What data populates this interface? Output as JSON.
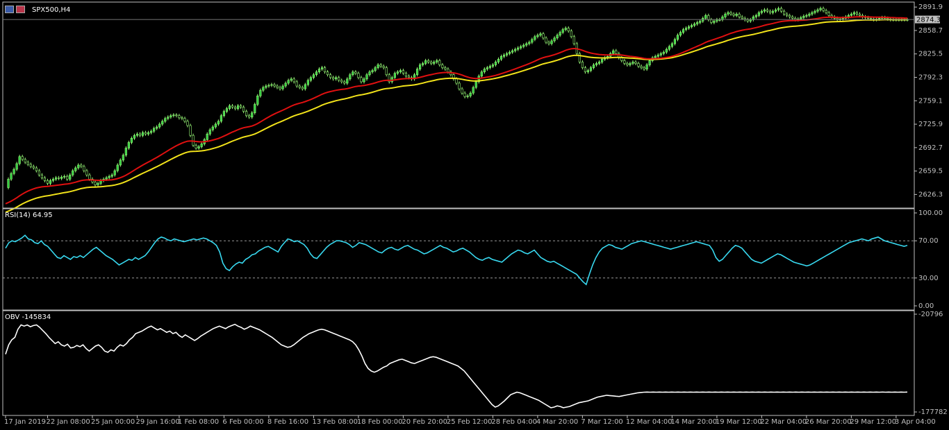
{
  "window": {
    "symbol_label": "SPX500,H4",
    "rsi_label": "RSI(14) 64.95",
    "obv_label": "OBV -145834",
    "current_price": "2874.3"
  },
  "colors": {
    "background": "#000000",
    "frame": "#c0c0c0",
    "bull_candle": "#2ecc40",
    "candle_wick": "#9cff7a",
    "ma_fast": "#e01010",
    "ma_slow": "#f2e31a",
    "rsi_line": "#38d9f0",
    "obv_line": "#ffffff",
    "level_line": "#b0b0b0"
  },
  "icons": [
    "chart-window-icon",
    "us-flag-icon"
  ],
  "chart_data": [
    {
      "type": "line",
      "name": "price",
      "title": "SPX500,H4",
      "ylim": [
        2609,
        2896
      ],
      "yticks": [
        "2891.9",
        "2858.7",
        "2825.5",
        "2792.3",
        "2759.1",
        "2725.9",
        "2692.7",
        "2659.5",
        "2626.3"
      ],
      "ytick_values": [
        2891.9,
        2858.7,
        2825.5,
        2792.3,
        2759.1,
        2725.9,
        2692.7,
        2659.5,
        2626.3
      ],
      "xticks": [
        "17 Jan 2019",
        "22 Jan 08:00",
        "25 Jan 00:00",
        "29 Jan 16:00",
        "1 Feb 08:00",
        "6 Feb 00:00",
        "8 Feb 16:00",
        "13 Feb 08:00",
        "18 Feb 00:00",
        "20 Feb 20:00",
        "25 Feb 12:00",
        "28 Feb 04:00",
        "4 Mar 20:00",
        "7 Mar 12:00",
        "12 Mar 04:00",
        "14 Mar 20:00",
        "19 Mar 12:00",
        "22 Mar 04:00",
        "26 Mar 20:00",
        "29 Mar 12:00",
        "3 Apr 04:00"
      ],
      "xtick_index": [
        0,
        15,
        31,
        47,
        62,
        78,
        94,
        110,
        126,
        142,
        158,
        174,
        190,
        206,
        222,
        238,
        254,
        270,
        286,
        302,
        318
      ],
      "close": [
        2636,
        2648,
        2656,
        2662,
        2670,
        2680,
        2676,
        2672,
        2669,
        2666,
        2664,
        2660,
        2654,
        2650,
        2646,
        2642,
        2646,
        2648,
        2650,
        2649,
        2651,
        2652,
        2648,
        2654,
        2660,
        2664,
        2668,
        2666,
        2660,
        2654,
        2648,
        2644,
        2640,
        2642,
        2646,
        2648,
        2650,
        2652,
        2654,
        2660,
        2668,
        2675,
        2682,
        2692,
        2700,
        2706,
        2710,
        2712,
        2710,
        2714,
        2712,
        2714,
        2716,
        2720,
        2722,
        2726,
        2730,
        2734,
        2736,
        2738,
        2739,
        2738,
        2735,
        2734,
        2730,
        2724,
        2710,
        2696,
        2692,
        2694,
        2698,
        2704,
        2712,
        2718,
        2722,
        2726,
        2730,
        2738,
        2744,
        2748,
        2752,
        2750,
        2748,
        2752,
        2750,
        2744,
        2738,
        2736,
        2742,
        2754,
        2766,
        2774,
        2778,
        2780,
        2781,
        2782,
        2780,
        2778,
        2776,
        2780,
        2784,
        2788,
        2790,
        2786,
        2780,
        2778,
        2776,
        2782,
        2788,
        2792,
        2796,
        2800,
        2804,
        2806,
        2800,
        2796,
        2792,
        2790,
        2792,
        2788,
        2786,
        2784,
        2790,
        2796,
        2800,
        2798,
        2792,
        2786,
        2790,
        2796,
        2800,
        2802,
        2806,
        2810,
        2808,
        2806,
        2796,
        2786,
        2792,
        2798,
        2800,
        2802,
        2798,
        2794,
        2792,
        2790,
        2796,
        2804,
        2810,
        2812,
        2816,
        2814,
        2812,
        2814,
        2816,
        2810,
        2806,
        2804,
        2800,
        2796,
        2790,
        2784,
        2776,
        2770,
        2765,
        2766,
        2770,
        2778,
        2786,
        2794,
        2800,
        2804,
        2806,
        2808,
        2810,
        2814,
        2818,
        2822,
        2824,
        2826,
        2828,
        2830,
        2832,
        2834,
        2836,
        2838,
        2840,
        2842,
        2846,
        2850,
        2852,
        2854,
        2848,
        2842,
        2840,
        2844,
        2848,
        2852,
        2856,
        2860,
        2862,
        2858,
        2850,
        2840,
        2826,
        2814,
        2806,
        2800,
        2802,
        2806,
        2810,
        2812,
        2814,
        2818,
        2820,
        2822,
        2826,
        2830,
        2826,
        2820,
        2816,
        2812,
        2810,
        2812,
        2814,
        2812,
        2808,
        2806,
        2804,
        2810,
        2816,
        2820,
        2822,
        2824,
        2826,
        2828,
        2832,
        2836,
        2840,
        2846,
        2852,
        2856,
        2860,
        2862,
        2864,
        2866,
        2868,
        2870,
        2872,
        2876,
        2880,
        2874,
        2870,
        2872,
        2874,
        2874,
        2878,
        2882,
        2884,
        2882,
        2880,
        2882,
        2878,
        2876,
        2874,
        2872,
        2874,
        2878,
        2880,
        2884,
        2886,
        2888,
        2886,
        2884,
        2886,
        2888,
        2890,
        2886,
        2882,
        2880,
        2878,
        2876,
        2874,
        2875,
        2877,
        2879,
        2880,
        2882,
        2884,
        2886,
        2888,
        2890,
        2887,
        2884,
        2880,
        2878,
        2876,
        2874,
        2875,
        2876,
        2878,
        2880,
        2882,
        2884,
        2882,
        2880,
        2878,
        2877,
        2876,
        2875,
        2874,
        2875,
        2876,
        2877,
        2876,
        2875,
        2874,
        2874,
        2874,
        2874,
        2874,
        2874,
        2874
      ],
      "series": [
        {
          "name": "ma_fast",
          "start": 2612,
          "end": 2847
        },
        {
          "name": "ma_slow",
          "start": 2600,
          "end": 2830
        }
      ],
      "current_price": 2874.3
    },
    {
      "type": "line",
      "name": "rsi",
      "title": "RSI(14) 64.95",
      "ylim": [
        0,
        100
      ],
      "yticks": [
        "100.00",
        "70.00",
        "30.00",
        "0.00"
      ],
      "ytick_values": [
        100,
        70,
        30,
        0
      ],
      "levels": [
        70,
        30
      ],
      "values": [
        62,
        68,
        70,
        69,
        71,
        73,
        76,
        72,
        71,
        68,
        67,
        70,
        66,
        64,
        60,
        56,
        52,
        51,
        54,
        52,
        50,
        53,
        52,
        54,
        52,
        55,
        58,
        61,
        63,
        60,
        57,
        54,
        52,
        50,
        47,
        44,
        46,
        48,
        50,
        49,
        52,
        50,
        52,
        54,
        58,
        63,
        68,
        72,
        74,
        73,
        71,
        70,
        72,
        71,
        70,
        69,
        70,
        71,
        72,
        71,
        72,
        73,
        72,
        70,
        68,
        65,
        58,
        46,
        40,
        38,
        42,
        45,
        47,
        46,
        50,
        52,
        55,
        56,
        59,
        61,
        63,
        64,
        62,
        60,
        58,
        64,
        68,
        72,
        71,
        69,
        70,
        68,
        66,
        62,
        56,
        52,
        51,
        55,
        59,
        63,
        66,
        68,
        70,
        70,
        69,
        68,
        66,
        63,
        65,
        68,
        67,
        66,
        64,
        62,
        60,
        58,
        57,
        60,
        62,
        63,
        61,
        60,
        62,
        64,
        65,
        63,
        61,
        60,
        58,
        56,
        57,
        59,
        61,
        63,
        65,
        63,
        62,
        60,
        58,
        59,
        61,
        62,
        60,
        58,
        55,
        52,
        50,
        49,
        51,
        52,
        50,
        49,
        48,
        47,
        50,
        53,
        56,
        58,
        60,
        59,
        57,
        56,
        58,
        60,
        56,
        52,
        50,
        48,
        47,
        48,
        46,
        44,
        42,
        40,
        38,
        36,
        34,
        30,
        26,
        23,
        34,
        44,
        52,
        58,
        62,
        64,
        66,
        65,
        63,
        62,
        61,
        63,
        65,
        67,
        68,
        69,
        70,
        69,
        68,
        67,
        66,
        65,
        64,
        63,
        62,
        61,
        62,
        63,
        64,
        65,
        66,
        67,
        68,
        69,
        68,
        67,
        66,
        65,
        60,
        52,
        48,
        50,
        54,
        58,
        62,
        65,
        64,
        62,
        58,
        54,
        50,
        48,
        47,
        46,
        48,
        50,
        52,
        54,
        56,
        55,
        53,
        51,
        49,
        47,
        46,
        45,
        44,
        43,
        44,
        46,
        48,
        50,
        52,
        54,
        56,
        58,
        60,
        62,
        64,
        66,
        68,
        69,
        70,
        71,
        72,
        71,
        70,
        72,
        73,
        74,
        72,
        70,
        69,
        68,
        67,
        66,
        65,
        64,
        65
      ],
      "current": 64.95
    },
    {
      "type": "line",
      "name": "obv",
      "title": "OBV -145834",
      "ylim": [
        -177782,
        -20796
      ],
      "yticks": [
        "-20796",
        "-177782"
      ],
      "ytick_values": [
        -20796,
        -177782
      ],
      "values": [
        -85000,
        -70000,
        -62000,
        -58000,
        -45000,
        -38000,
        -40000,
        -38000,
        -41000,
        -39000,
        -38000,
        -42000,
        -47000,
        -52000,
        -58000,
        -63000,
        -68000,
        -65000,
        -70000,
        -72000,
        -69000,
        -75000,
        -74000,
        -71000,
        -73000,
        -70000,
        -76000,
        -80000,
        -76000,
        -72000,
        -70000,
        -74000,
        -80000,
        -82000,
        -78000,
        -80000,
        -74000,
        -70000,
        -72000,
        -68000,
        -62000,
        -58000,
        -52000,
        -50000,
        -48000,
        -45000,
        -42000,
        -40000,
        -43000,
        -46000,
        -44000,
        -47000,
        -50000,
        -48000,
        -52000,
        -50000,
        -55000,
        -58000,
        -54000,
        -57000,
        -60000,
        -63000,
        -60000,
        -56000,
        -53000,
        -50000,
        -47000,
        -44000,
        -42000,
        -40000,
        -42000,
        -44000,
        -41000,
        -39000,
        -37000,
        -40000,
        -42000,
        -45000,
        -43000,
        -40000,
        -42000,
        -44000,
        -46000,
        -49000,
        -52000,
        -55000,
        -58000,
        -62000,
        -66000,
        -70000,
        -72000,
        -74000,
        -73000,
        -70000,
        -66000,
        -62000,
        -58000,
        -55000,
        -52000,
        -50000,
        -48000,
        -46000,
        -45000,
        -46000,
        -48000,
        -50000,
        -52000,
        -54000,
        -56000,
        -58000,
        -60000,
        -62000,
        -65000,
        -70000,
        -78000,
        -88000,
        -100000,
        -108000,
        -112000,
        -114000,
        -112000,
        -109000,
        -106000,
        -104000,
        -100000,
        -98000,
        -96000,
        -94000,
        -93000,
        -95000,
        -97000,
        -99000,
        -100000,
        -98000,
        -96000,
        -94000,
        -92000,
        -90000,
        -89000,
        -90000,
        -92000,
        -94000,
        -96000,
        -98000,
        -100000,
        -102000,
        -104000,
        -108000,
        -112000,
        -118000,
        -124000,
        -130000,
        -136000,
        -142000,
        -148000,
        -154000,
        -160000,
        -166000,
        -170000,
        -168000,
        -164000,
        -160000,
        -155000,
        -150000,
        -148000,
        -146000,
        -147000,
        -149000,
        -151000,
        -153000,
        -155000,
        -157000,
        -159000,
        -162000,
        -165000,
        -168000,
        -171000,
        -170000,
        -168000,
        -169000,
        -171000,
        -170000,
        -169000,
        -167000,
        -165000,
        -163000,
        -162000,
        -161000,
        -160000,
        -158000,
        -156000,
        -154000,
        -153000,
        -152000,
        -151000,
        -151500,
        -152000,
        -152500,
        -153000,
        -152000,
        -151000,
        -150000,
        -149000,
        -148000,
        -147000,
        -146500,
        -146000,
        -145834,
        -146000,
        -145834,
        -146000,
        -145834,
        -146000,
        -145834,
        -146000,
        -145834,
        -146000,
        -145834,
        -146000,
        -145834,
        -146000,
        -145834,
        -146000,
        -145834,
        -146000,
        -145834,
        -146000,
        -145834,
        -146000,
        -145834,
        -146000,
        -145834,
        -146000,
        -145834,
        -146000,
        -145834,
        -146000,
        -145834,
        -146000,
        -145834,
        -146000,
        -145834,
        -146000,
        -145834,
        -146000,
        -145834,
        -146000,
        -145834,
        -146000,
        -145834,
        -146000,
        -145834,
        -146000,
        -145834,
        -146000,
        -145834,
        -146000,
        -145834,
        -146000,
        -145834,
        -146000,
        -145834,
        -146000,
        -145834,
        -146000,
        -145834,
        -146000,
        -145834,
        -146000,
        -145834,
        -146000,
        -145834,
        -146000,
        -145834,
        -146000,
        -145834,
        -146000,
        -145834,
        -146000,
        -145834,
        -146000,
        -145834,
        -146000,
        -145834,
        -146000,
        -145834,
        -146000,
        -145834,
        -146000,
        -145834,
        -146000,
        -145834
      ],
      "current": -145834
    }
  ]
}
